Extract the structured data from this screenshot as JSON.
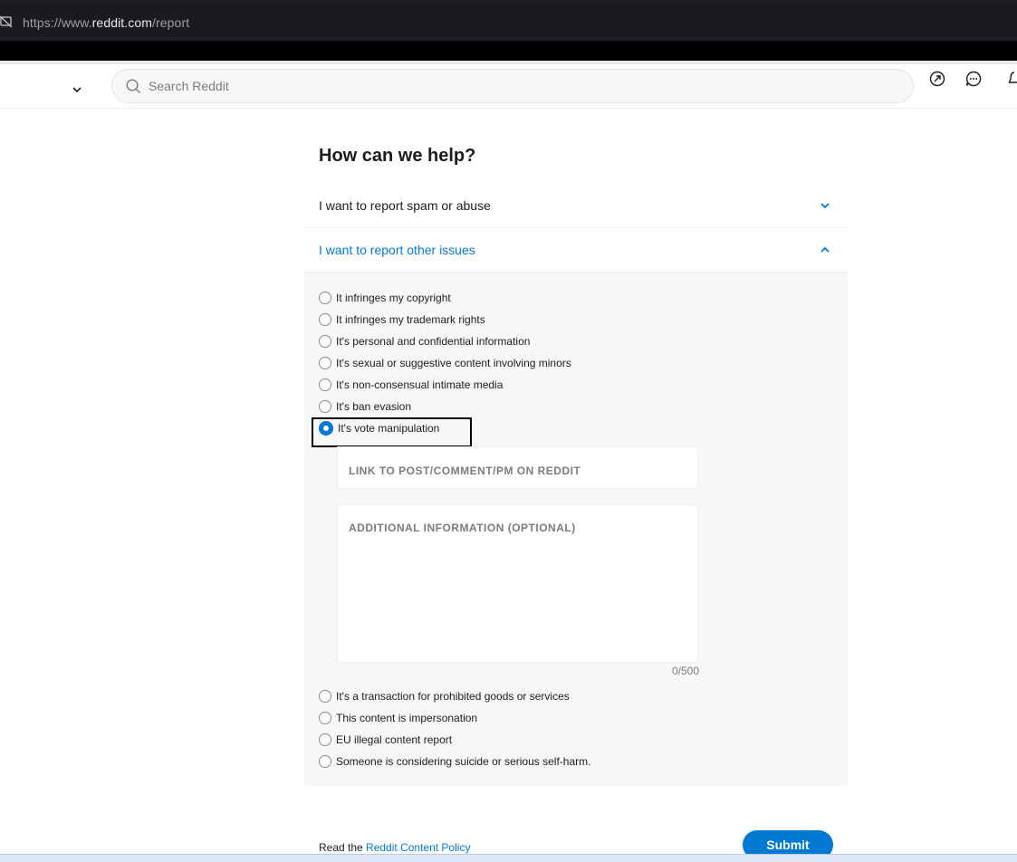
{
  "browser": {
    "url_prefix": "https://www.",
    "url_domain": "reddit.com",
    "url_path": "/report"
  },
  "header": {
    "search_placeholder": "Search Reddit",
    "icons": [
      "chevron-down-icon",
      "search-icon",
      "popular-arrow-icon",
      "chat-icon",
      "notification-bell-icon"
    ]
  },
  "main": {
    "title": "How can we help?",
    "accordion": [
      {
        "label": "I want to report spam or abuse",
        "state": "collapsed"
      },
      {
        "label": "I want to report other issues",
        "state": "expanded"
      }
    ],
    "options": [
      {
        "label": "It infringes my copyright",
        "selected": false
      },
      {
        "label": "It infringes my trademark rights",
        "selected": false
      },
      {
        "label": "It's personal and confidential information",
        "selected": false
      },
      {
        "label": "It's sexual or suggestive content involving minors",
        "selected": false
      },
      {
        "label": "It's non-consensual intimate media",
        "selected": false
      },
      {
        "label": "It's ban evasion",
        "selected": false
      },
      {
        "label": "It's vote manipulation",
        "selected": true
      },
      {
        "label": "It's a transaction for prohibited goods or services",
        "selected": false
      },
      {
        "label": "This content is impersonation",
        "selected": false
      },
      {
        "label": "EU illegal content report",
        "selected": false
      },
      {
        "label": "Someone is considering suicide or serious self-harm.",
        "selected": false
      }
    ],
    "link_field_placeholder": "LINK TO POST/COMMENT/PM ON REDDIT",
    "info_field_placeholder": "ADDITIONAL INFORMATION (OPTIONAL)",
    "char_counter": "0/500"
  },
  "footer": {
    "policy_prefix": "Read the",
    "policy_link": "Reddit Content Policy",
    "submit_label": "Submit"
  },
  "colors": {
    "accent": "#0079d3",
    "panel_bg": "#f6f7f8"
  }
}
